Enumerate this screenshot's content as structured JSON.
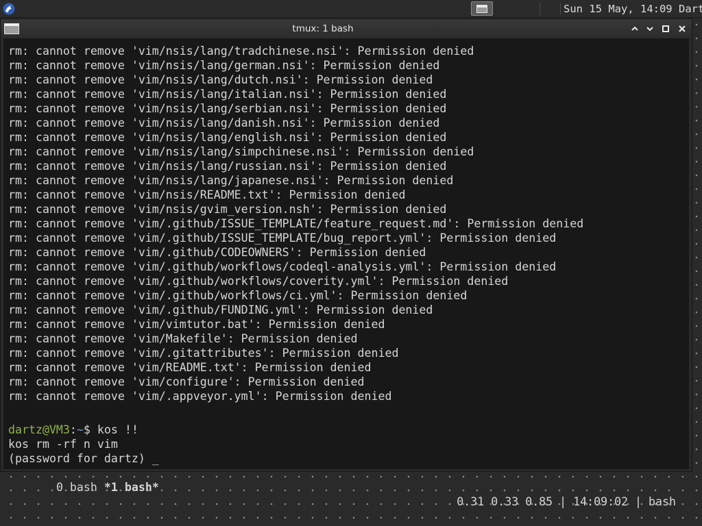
{
  "top_panel": {
    "app_menu_icon": "distro-logo-icon",
    "task_icon": "window-icon",
    "clock": "Sun 15 May, 14:09",
    "user": "Dartz"
  },
  "window": {
    "title": "tmux: 1 bash",
    "buttons": [
      "minimize-icon",
      "maximize-icon",
      "close-icon"
    ]
  },
  "terminal": {
    "lines": [
      "rm: cannot remove 'vim/nsis/lang/tradchinese.nsi': Permission denied",
      "rm: cannot remove 'vim/nsis/lang/german.nsi': Permission denied",
      "rm: cannot remove 'vim/nsis/lang/dutch.nsi': Permission denied",
      "rm: cannot remove 'vim/nsis/lang/italian.nsi': Permission denied",
      "rm: cannot remove 'vim/nsis/lang/serbian.nsi': Permission denied",
      "rm: cannot remove 'vim/nsis/lang/danish.nsi': Permission denied",
      "rm: cannot remove 'vim/nsis/lang/english.nsi': Permission denied",
      "rm: cannot remove 'vim/nsis/lang/simpchinese.nsi': Permission denied",
      "rm: cannot remove 'vim/nsis/lang/russian.nsi': Permission denied",
      "rm: cannot remove 'vim/nsis/lang/japanese.nsi': Permission denied",
      "rm: cannot remove 'vim/nsis/README.txt': Permission denied",
      "rm: cannot remove 'vim/nsis/gvim_version.nsh': Permission denied",
      "rm: cannot remove 'vim/.github/ISSUE_TEMPLATE/feature_request.md': Permission denied",
      "rm: cannot remove 'vim/.github/ISSUE_TEMPLATE/bug_report.yml': Permission denied",
      "rm: cannot remove 'vim/.github/CODEOWNERS': Permission denied",
      "rm: cannot remove 'vim/.github/workflows/codeql-analysis.yml': Permission denied",
      "rm: cannot remove 'vim/.github/workflows/coverity.yml': Permission denied",
      "rm: cannot remove 'vim/.github/workflows/ci.yml': Permission denied",
      "rm: cannot remove 'vim/.github/FUNDING.yml': Permission denied",
      "rm: cannot remove 'vim/vimtutor.bat': Permission denied",
      "rm: cannot remove 'vim/Makefile': Permission denied",
      "rm: cannot remove 'vim/.gitattributes': Permission denied",
      "rm: cannot remove 'vim/README.txt': Permission denied",
      "rm: cannot remove 'vim/configure': Permission denied",
      "rm: cannot remove 'vim/.appveyor.yml': Permission denied"
    ],
    "prompt": {
      "user_host": "dartz@VM3",
      "sep": ":",
      "path": "~",
      "symbol": "$ ",
      "command": "kos !!"
    },
    "expanded_command": "kos rm -rf n vim",
    "password_prompt": "(password for dartz) ",
    "cursor": "_"
  },
  "tmux_status": {
    "window_0": " 0 bash ",
    "window_1": "*1 bash*",
    "right": "0.31 0.33 0.85 | 14:09:02 | bash"
  },
  "colors": {
    "prompt_user": "#8fb34a",
    "prompt_path": "#6f9fcf",
    "terminal_bg": "#181818",
    "terminal_fg": "#d6d6d6"
  }
}
